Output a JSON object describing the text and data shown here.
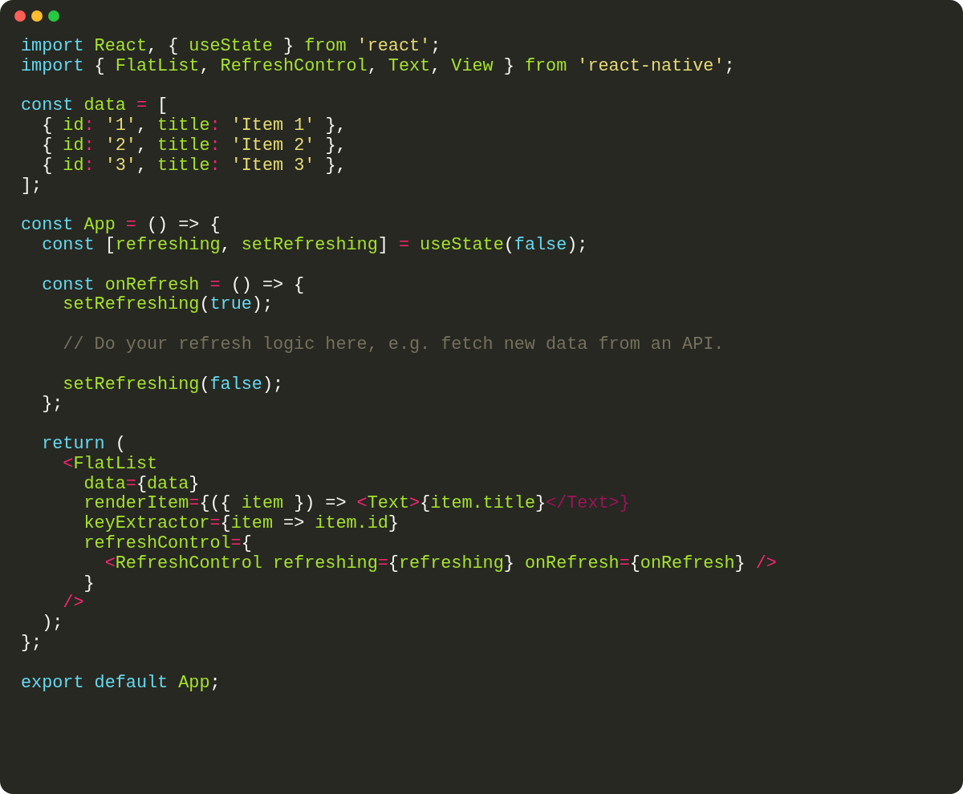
{
  "code_lines": [
    {
      "kind": "code",
      "tokens": [
        {
          "text": "import ",
          "kind": "keyword"
        },
        {
          "text": "React",
          "kind": "name"
        },
        {
          "text": ", { ",
          "kind": "punctuation"
        },
        {
          "text": "useState",
          "kind": "name"
        },
        {
          "text": " } ",
          "kind": "punctuation"
        },
        {
          "text": "from ",
          "kind": "name"
        },
        {
          "text": "'react'",
          "kind": "string"
        },
        {
          "text": ";",
          "kind": "punctuation"
        }
      ]
    },
    {
      "kind": "code",
      "tokens": [
        {
          "text": "import",
          "kind": "keyword"
        },
        {
          "text": " { ",
          "kind": "punctuation"
        },
        {
          "text": "FlatList",
          "kind": "name"
        },
        {
          "text": ", ",
          "kind": "punctuation"
        },
        {
          "text": "RefreshControl",
          "kind": "name"
        },
        {
          "text": ", ",
          "kind": "punctuation"
        },
        {
          "text": "Text",
          "kind": "name"
        },
        {
          "text": ", ",
          "kind": "punctuation"
        },
        {
          "text": "View",
          "kind": "name"
        },
        {
          "text": " } ",
          "kind": "punctuation"
        },
        {
          "text": "from ",
          "kind": "name"
        },
        {
          "text": "'react-native'",
          "kind": "string"
        },
        {
          "text": ";",
          "kind": "punctuation"
        }
      ]
    },
    {
      "kind": "blank"
    },
    {
      "kind": "code",
      "tokens": [
        {
          "text": "const ",
          "kind": "keyword"
        },
        {
          "text": "data ",
          "kind": "name"
        },
        {
          "text": "=",
          "kind": "operator"
        },
        {
          "text": " [",
          "kind": "punctuation"
        }
      ]
    },
    {
      "kind": "code",
      "tokens": [
        {
          "text": "  { ",
          "kind": "punctuation"
        },
        {
          "text": "id",
          "kind": "name"
        },
        {
          "text": ": ",
          "kind": "operator"
        },
        {
          "text": "'1'",
          "kind": "string"
        },
        {
          "text": ", ",
          "kind": "punctuation"
        },
        {
          "text": "title",
          "kind": "name"
        },
        {
          "text": ": ",
          "kind": "operator"
        },
        {
          "text": "'Item 1'",
          "kind": "string"
        },
        {
          "text": " },",
          "kind": "punctuation"
        }
      ]
    },
    {
      "kind": "code",
      "tokens": [
        {
          "text": "  { ",
          "kind": "punctuation"
        },
        {
          "text": "id",
          "kind": "name"
        },
        {
          "text": ": ",
          "kind": "operator"
        },
        {
          "text": "'2'",
          "kind": "string"
        },
        {
          "text": ", ",
          "kind": "punctuation"
        },
        {
          "text": "title",
          "kind": "name"
        },
        {
          "text": ": ",
          "kind": "operator"
        },
        {
          "text": "'Item 2'",
          "kind": "string"
        },
        {
          "text": " },",
          "kind": "punctuation"
        }
      ]
    },
    {
      "kind": "code",
      "tokens": [
        {
          "text": "  { ",
          "kind": "punctuation"
        },
        {
          "text": "id",
          "kind": "name"
        },
        {
          "text": ": ",
          "kind": "operator"
        },
        {
          "text": "'3'",
          "kind": "string"
        },
        {
          "text": ", ",
          "kind": "punctuation"
        },
        {
          "text": "title",
          "kind": "name"
        },
        {
          "text": ": ",
          "kind": "operator"
        },
        {
          "text": "'Item 3'",
          "kind": "string"
        },
        {
          "text": " },",
          "kind": "punctuation"
        }
      ]
    },
    {
      "kind": "code",
      "tokens": [
        {
          "text": "];",
          "kind": "punctuation"
        }
      ]
    },
    {
      "kind": "blank"
    },
    {
      "kind": "code",
      "tokens": [
        {
          "text": "const ",
          "kind": "keyword"
        },
        {
          "text": "App ",
          "kind": "name"
        },
        {
          "text": "=",
          "kind": "operator"
        },
        {
          "text": " () => {",
          "kind": "punctuation"
        }
      ]
    },
    {
      "kind": "code",
      "tokens": [
        {
          "text": "  const",
          "kind": "keyword"
        },
        {
          "text": " [",
          "kind": "punctuation"
        },
        {
          "text": "refreshing",
          "kind": "name"
        },
        {
          "text": ", ",
          "kind": "punctuation"
        },
        {
          "text": "setRefreshing",
          "kind": "name"
        },
        {
          "text": "] ",
          "kind": "punctuation"
        },
        {
          "text": "= ",
          "kind": "operator"
        },
        {
          "text": "useState",
          "kind": "name"
        },
        {
          "text": "(",
          "kind": "punctuation"
        },
        {
          "text": "false",
          "kind": "keyword"
        },
        {
          "text": ");",
          "kind": "punctuation"
        }
      ]
    },
    {
      "kind": "blank"
    },
    {
      "kind": "code",
      "tokens": [
        {
          "text": "  const ",
          "kind": "keyword"
        },
        {
          "text": "onRefresh ",
          "kind": "name"
        },
        {
          "text": "=",
          "kind": "operator"
        },
        {
          "text": " () => {",
          "kind": "punctuation"
        }
      ]
    },
    {
      "kind": "code",
      "tokens": [
        {
          "text": "    setRefreshing",
          "kind": "name"
        },
        {
          "text": "(",
          "kind": "punctuation"
        },
        {
          "text": "true",
          "kind": "keyword"
        },
        {
          "text": ");",
          "kind": "punctuation"
        }
      ]
    },
    {
      "kind": "blank"
    },
    {
      "kind": "code",
      "tokens": [
        {
          "text": "    // Do your refresh logic here, e.g. fetch new data from an API.",
          "kind": "comment"
        }
      ]
    },
    {
      "kind": "blank"
    },
    {
      "kind": "code",
      "tokens": [
        {
          "text": "    setRefreshing",
          "kind": "name"
        },
        {
          "text": "(",
          "kind": "punctuation"
        },
        {
          "text": "false",
          "kind": "keyword"
        },
        {
          "text": ");",
          "kind": "punctuation"
        }
      ]
    },
    {
      "kind": "code",
      "tokens": [
        {
          "text": "  };",
          "kind": "punctuation"
        }
      ]
    },
    {
      "kind": "blank"
    },
    {
      "kind": "code",
      "tokens": [
        {
          "text": "  return",
          "kind": "keyword"
        },
        {
          "text": " (",
          "kind": "punctuation"
        }
      ]
    },
    {
      "kind": "code",
      "tokens": [
        {
          "text": "    <",
          "kind": "operator"
        },
        {
          "text": "FlatList",
          "kind": "name"
        }
      ]
    },
    {
      "kind": "code",
      "tokens": [
        {
          "text": "      data",
          "kind": "name"
        },
        {
          "text": "=",
          "kind": "operator"
        },
        {
          "text": "{",
          "kind": "punctuation"
        },
        {
          "text": "data",
          "kind": "name"
        },
        {
          "text": "}",
          "kind": "punctuation"
        }
      ]
    },
    {
      "kind": "code",
      "tokens": [
        {
          "text": "      renderItem",
          "kind": "name"
        },
        {
          "text": "=",
          "kind": "operator"
        },
        {
          "text": "{({ ",
          "kind": "punctuation"
        },
        {
          "text": "item",
          "kind": "name"
        },
        {
          "text": " }) => ",
          "kind": "punctuation"
        },
        {
          "text": "<",
          "kind": "operator"
        },
        {
          "text": "Text",
          "kind": "name"
        },
        {
          "text": ">",
          "kind": "operator"
        },
        {
          "text": "{",
          "kind": "punctuation"
        },
        {
          "text": "item.title",
          "kind": "name"
        },
        {
          "text": "}",
          "kind": "punctuation"
        },
        {
          "text": "</Text>}",
          "kind": "error"
        }
      ]
    },
    {
      "kind": "code",
      "tokens": [
        {
          "text": "      keyExtractor",
          "kind": "name"
        },
        {
          "text": "=",
          "kind": "operator"
        },
        {
          "text": "{",
          "kind": "punctuation"
        },
        {
          "text": "item",
          "kind": "name"
        },
        {
          "text": " => ",
          "kind": "punctuation"
        },
        {
          "text": "item.id",
          "kind": "name"
        },
        {
          "text": "}",
          "kind": "punctuation"
        }
      ]
    },
    {
      "kind": "code",
      "tokens": [
        {
          "text": "      refreshControl",
          "kind": "name"
        },
        {
          "text": "=",
          "kind": "operator"
        },
        {
          "text": "{",
          "kind": "punctuation"
        }
      ]
    },
    {
      "kind": "code",
      "tokens": [
        {
          "text": "        <",
          "kind": "operator"
        },
        {
          "text": "RefreshControl refreshing",
          "kind": "name"
        },
        {
          "text": "=",
          "kind": "operator"
        },
        {
          "text": "{",
          "kind": "punctuation"
        },
        {
          "text": "refreshing",
          "kind": "name"
        },
        {
          "text": "} ",
          "kind": "punctuation"
        },
        {
          "text": "onRefresh",
          "kind": "name"
        },
        {
          "text": "=",
          "kind": "operator"
        },
        {
          "text": "{",
          "kind": "punctuation"
        },
        {
          "text": "onRefresh",
          "kind": "name"
        },
        {
          "text": "} ",
          "kind": "punctuation"
        },
        {
          "text": "/>",
          "kind": "operator"
        }
      ]
    },
    {
      "kind": "code",
      "tokens": [
        {
          "text": "      }",
          "kind": "punctuation"
        }
      ]
    },
    {
      "kind": "code",
      "tokens": [
        {
          "text": "    />",
          "kind": "operator"
        }
      ]
    },
    {
      "kind": "code",
      "tokens": [
        {
          "text": "  );",
          "kind": "punctuation"
        }
      ]
    },
    {
      "kind": "code",
      "tokens": [
        {
          "text": "};",
          "kind": "punctuation"
        }
      ]
    },
    {
      "kind": "blank"
    },
    {
      "kind": "code",
      "tokens": [
        {
          "text": "export ",
          "kind": "keyword"
        },
        {
          "text": "default ",
          "kind": "keyword"
        },
        {
          "text": "App",
          "kind": "name"
        },
        {
          "text": ";",
          "kind": "punctuation"
        }
      ]
    }
  ]
}
